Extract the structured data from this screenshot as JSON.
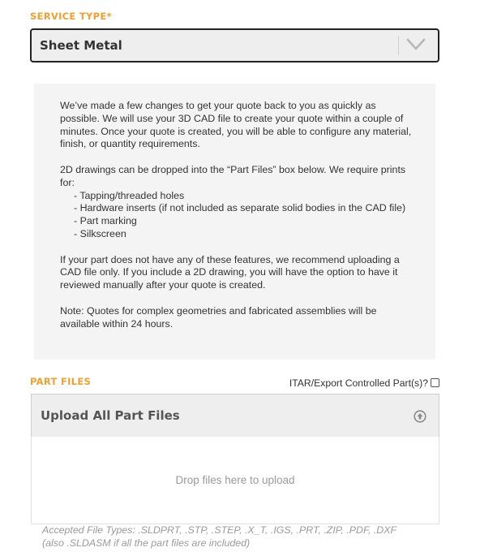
{
  "service": {
    "label": "SERVICE TYPE*",
    "selected": "Sheet Metal",
    "dropdown_icon": "chevron-down-icon"
  },
  "info": {
    "p1": "We’ve made a few changes to get your quote back to you as quickly as possible. We will use your 3D CAD file to create your quote within a couple of minutes. Once your quote is created, you will be able to configure any material, finish, or quantity requirements.",
    "p2": "2D drawings can be dropped into the “Part Files” box below. We require prints for:",
    "items": [
      "- Tapping/threaded holes",
      "- Hardware inserts (if not included as separate solid bodies in the CAD file)",
      "- Part marking",
      "- Silkscreen"
    ],
    "p3": "If your part does not have any of these features, we recommend uploading a CAD file only. If you include a 2D drawing, you will have the option to have it reviewed manually after your quote is created.",
    "p4": "Note: Quotes for complex geometries and fabricated assemblies will be available within 24 hours."
  },
  "part_files": {
    "label": "PART FILES",
    "itar_label": "ITAR/Export Controlled Part(s)?",
    "itar_checked": false,
    "upload_title": "Upload All Part Files",
    "upload_icon": "upload-arrow-icon",
    "drop_text": "Drop files here to upload",
    "accepted_line1": "Accepted File Types: .SLDPRT, .STP, .STEP, .X_T, .IGS, .PRT, .ZIP, .PDF, .DXF",
    "accepted_line2": "(also .SLDASM if all the part files are included)"
  },
  "colors": {
    "accent": "#f0a030",
    "select_border": "#222222",
    "info_bg": "#f4f4f4"
  }
}
